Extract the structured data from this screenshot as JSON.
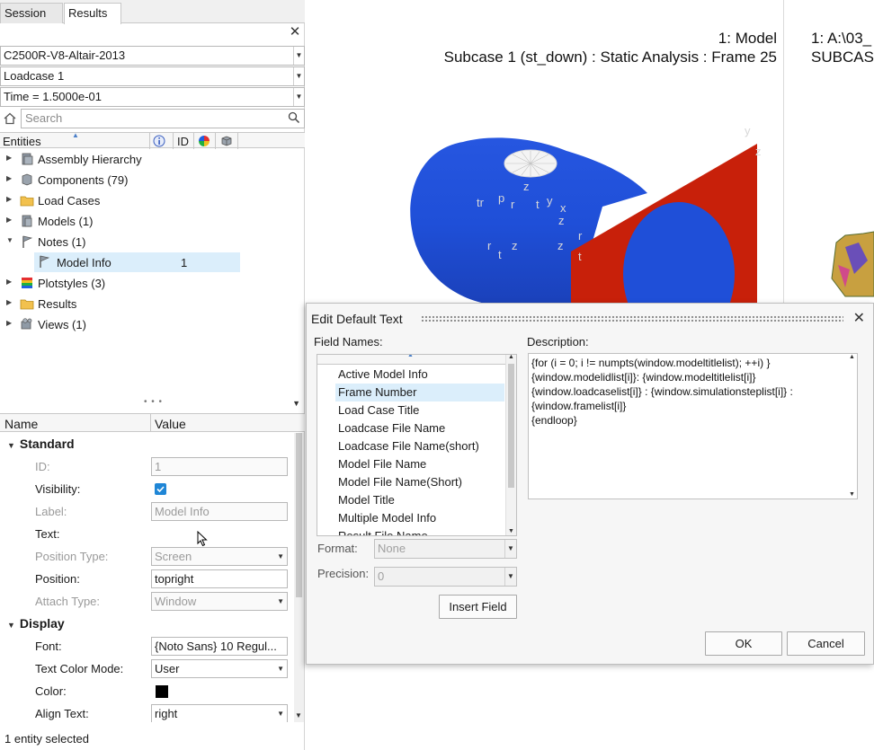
{
  "tabs": [
    {
      "label": "Session"
    },
    {
      "label": "Results"
    }
  ],
  "model_select": {
    "value": "C2500R-V8-Altair-2013"
  },
  "loadcase_select": {
    "value": "Loadcase 1"
  },
  "time_select": {
    "value": "Time = 1.5000e-01"
  },
  "search": {
    "placeholder": "Search"
  },
  "tree_header": {
    "entities": "Entities",
    "id": "ID"
  },
  "tree": [
    {
      "label": "Assembly Hierarchy"
    },
    {
      "label": "Components (79)"
    },
    {
      "label": "Load Cases"
    },
    {
      "label": "Models (1)"
    },
    {
      "label": "Notes (1)"
    },
    {
      "label": "Model Info",
      "id": "1"
    },
    {
      "label": "Plotstyles (3)"
    },
    {
      "label": "Results"
    },
    {
      "label": "Views (1)"
    }
  ],
  "props_header": {
    "name": "Name",
    "value": "Value"
  },
  "props": {
    "standard": "Standard",
    "id_label": "ID:",
    "id_value": "1",
    "visibility_label": "Visibility:",
    "label_label": "Label:",
    "label_value": "Model Info",
    "text_label": "Text:",
    "position_type_label": "Position Type:",
    "position_type_value": "Screen",
    "position_label": "Position:",
    "position_value": "topright",
    "attach_type_label": "Attach Type:",
    "attach_type_value": "Window",
    "display": "Display",
    "font_label": "Font:",
    "font_value": "{Noto Sans} 10 Regul...",
    "text_color_mode_label": "Text Color Mode:",
    "text_color_mode_value": "User",
    "color_label": "Color:",
    "color_value": "#000000",
    "align_text_label": "Align Text:",
    "align_text_value": "right"
  },
  "status": "1 entity selected",
  "viewport": {
    "model_line": "1: Model",
    "subcase_line": "Subcase 1 (st_down) : Static Analysis : Frame 25",
    "right_line1": "1: A:\\03_",
    "right_line2": "SUBCASE",
    "triad_labels": [
      "y",
      "z",
      "z",
      "tr",
      "p",
      "r",
      "t",
      "y",
      "x",
      "z",
      "r",
      "z",
      "t",
      "z",
      "r",
      "t"
    ]
  },
  "dialog": {
    "title": "Edit Default Text",
    "field_names_label": "Field Names:",
    "description_label": "Description:",
    "field_names": [
      "Active Model Info",
      "Frame Number",
      "Load Case Title",
      "Loadcase File Name",
      "Loadcase File Name(short)",
      "Model File Name",
      "Model File Name(Short)",
      "Model Title",
      "Multiple Model Info",
      "Result File Name"
    ],
    "description": "{for (i = 0; i != numpts(window.modeltitlelist); ++i) }\n{window.modelidlist[i]}: {window.modeltitlelist[i]}\n{window.loadcaselist[i]} : {window.simulationsteplist[i]} :\n{window.framelist[i]}\n{endloop}",
    "format_label": "Format:",
    "format_value": "None",
    "precision_label": "Precision:",
    "precision_value": "0",
    "insert_field": "Insert Field",
    "ok": "OK",
    "cancel": "Cancel"
  },
  "colors": {
    "blue_tube": "#1f4fd8",
    "red_plate": "#c8200a",
    "selection": "#dbeefb",
    "checkbox": "#1f86d6"
  }
}
